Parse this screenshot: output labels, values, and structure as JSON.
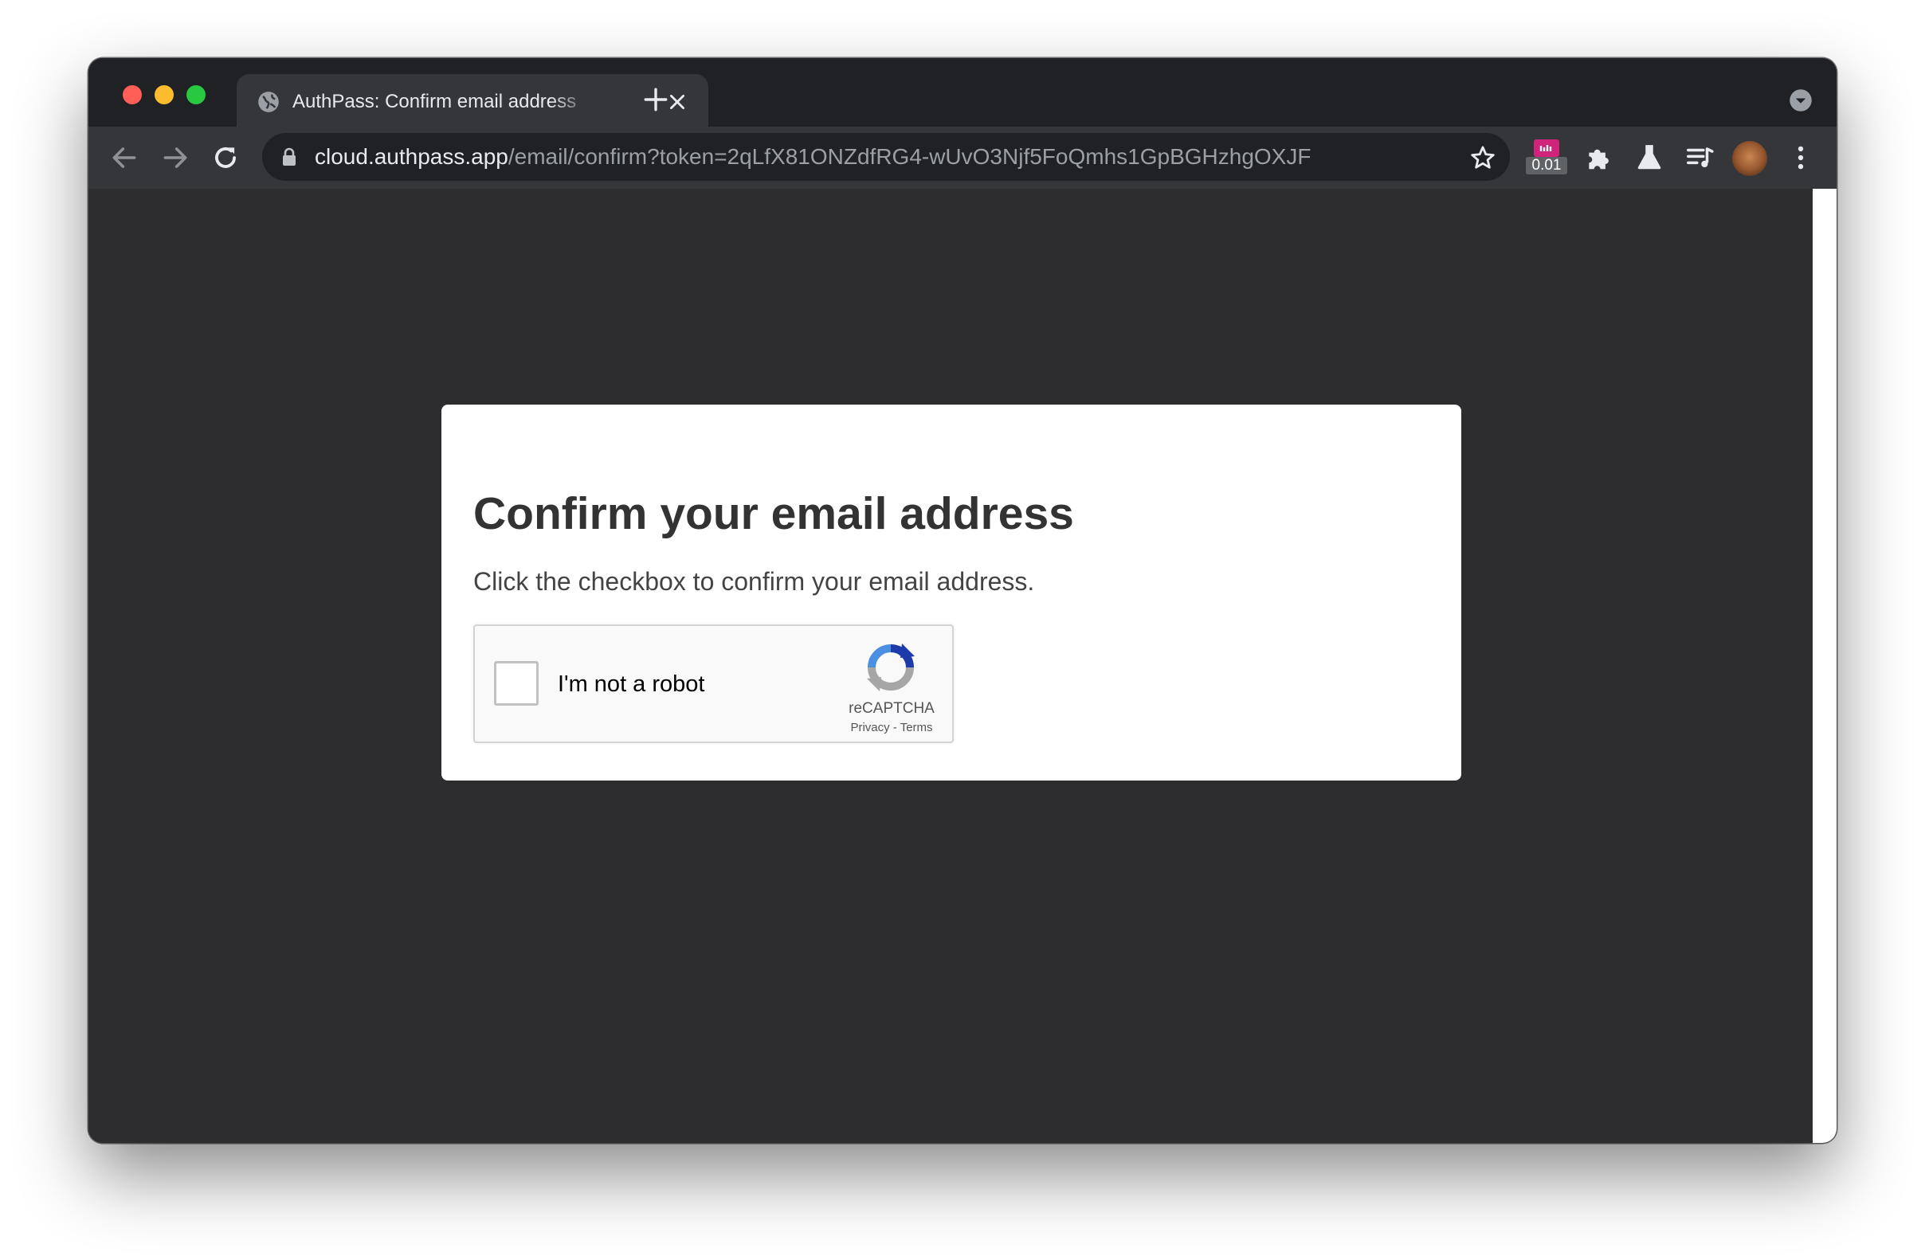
{
  "browser": {
    "tab": {
      "title": "AuthPass: Confirm email address"
    },
    "address_bar": {
      "host": "cloud.authpass.app",
      "path": "/email/confirm?token=2qLfX81ONZdfRG4-wUvO3Njf5FoQmhs1GpBGHzhgOXJF"
    },
    "extension_badge": "0.01",
    "icons": {
      "traffic_lights": [
        "close",
        "minimize",
        "maximize"
      ],
      "tab_favicon": "globe-icon",
      "toolbar": [
        "back-icon",
        "forward-icon",
        "reload-icon",
        "lock-icon",
        "star-icon",
        "extension-badge-icon",
        "puzzle-icon",
        "labs-flask-icon",
        "media-queue-icon",
        "profile-avatar",
        "menu-icon"
      ]
    }
  },
  "page": {
    "title": "Confirm your email address",
    "instruction": "Click the checkbox to confirm your email address.",
    "recaptcha": {
      "checkbox_label": "I'm not a robot",
      "brand": "reCAPTCHA",
      "privacy": "Privacy",
      "separator": "-",
      "terms": "Terms"
    }
  },
  "colors": {
    "page_background": "#2d2d2f",
    "card_background": "#ffffff",
    "titlebar": "#202124",
    "toolbar": "#35363a"
  }
}
